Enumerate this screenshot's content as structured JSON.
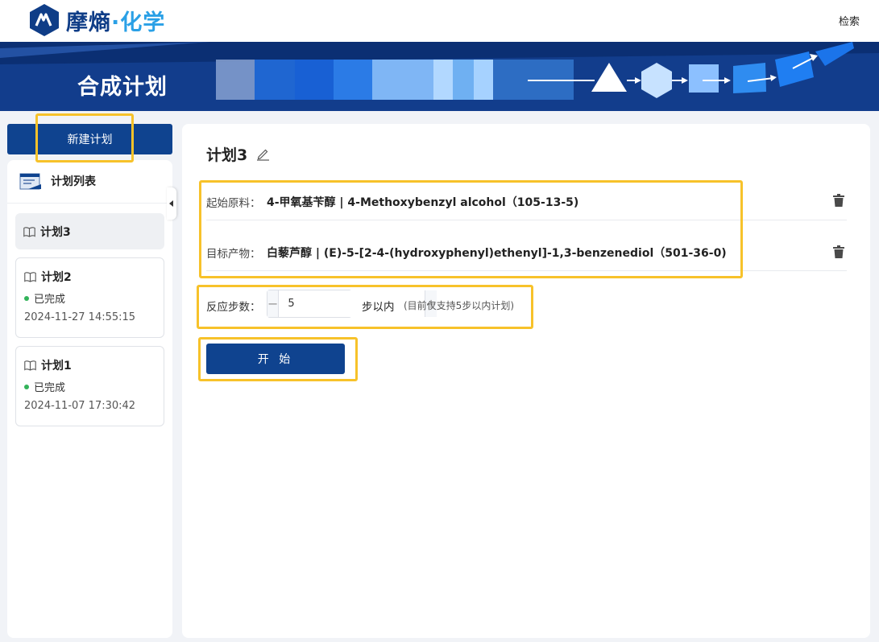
{
  "brand": {
    "name_part1": "摩熵",
    "dot": "·",
    "name_part2": "化学"
  },
  "nav": {
    "search": "检索"
  },
  "banner": {
    "title": "合成计划"
  },
  "sidebar": {
    "new_plan_button": "新建计划",
    "list_title": "计划列表",
    "plans": [
      {
        "name": "计划3",
        "status": "",
        "time": ""
      },
      {
        "name": "计划2",
        "status": "已完成",
        "time": "2024-11-27 14:55:15"
      },
      {
        "name": "计划1",
        "status": "已完成",
        "time": "2024-11-07 17:30:42"
      }
    ]
  },
  "main": {
    "title": "计划3",
    "start_material": {
      "label": "起始原料：",
      "value": "4-甲氧基苄醇 | 4-Methoxybenzyl alcohol（105-13-5)"
    },
    "target_product": {
      "label": "目标产物：",
      "value": "白藜芦醇 | (E)-5-[2-4-(hydroxyphenyl)ethenyl]-1,3-benzenediol（501-36-0)"
    },
    "steps": {
      "label": "反应步数：",
      "value": "5",
      "minus": "−",
      "plus": "+",
      "suffix": "步以内",
      "note": "(目前仅支持5步以内计划)"
    },
    "start_button": "开 始"
  },
  "colors": {
    "primary": "#0f438f",
    "banner": "#123d8c",
    "highlight": "#f7c22a",
    "status_done": "#33b35a"
  }
}
